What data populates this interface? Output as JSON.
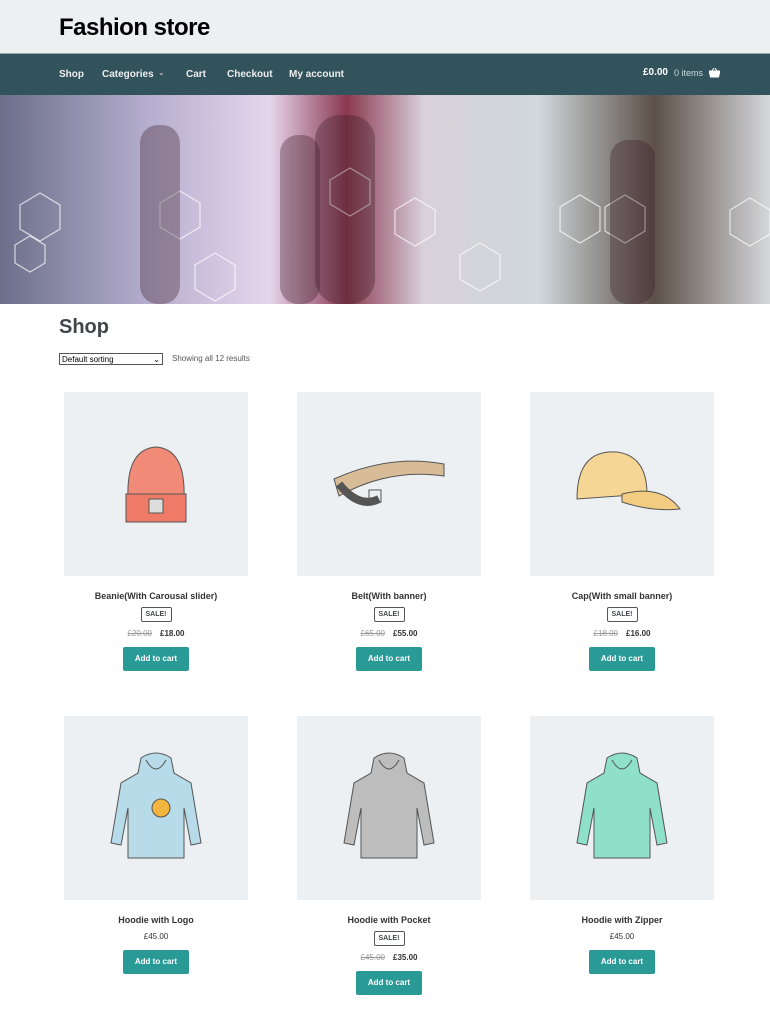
{
  "site": {
    "title": "Fashion store"
  },
  "nav": {
    "items": [
      "Shop",
      "Categories",
      "Cart",
      "Checkout",
      "My account"
    ],
    "cart_total": "£0.00",
    "cart_items": "0 items"
  },
  "page": {
    "title": "Shop",
    "sort": "Default sorting",
    "result_count": "Showing all 12 results"
  },
  "colors": {
    "nav": "#32525c",
    "button": "#2a9a96"
  },
  "products": [
    {
      "name": "Beanie(With Carousal slider)",
      "sale": "SALE!",
      "old_price": "£20.00",
      "price": "£18.00",
      "button": "Add to cart"
    },
    {
      "name": "Belt(With banner)",
      "sale": "SALE!",
      "old_price": "£65.00",
      "price": "£55.00",
      "button": "Add to cart"
    },
    {
      "name": "Cap(With small banner)",
      "sale": "SALE!",
      "old_price": "£18.00",
      "price": "£16.00",
      "button": "Add to cart"
    },
    {
      "name": "Hoodie with Logo",
      "price": "£45.00",
      "button": "Add to cart"
    },
    {
      "name": "Hoodie with Pocket",
      "sale": "SALE!",
      "old_price": "£45.00",
      "price": "£35.00",
      "button": "Add to cart"
    },
    {
      "name": "Hoodie with Zipper",
      "price": "£45.00",
      "button": "Add to cart"
    }
  ]
}
